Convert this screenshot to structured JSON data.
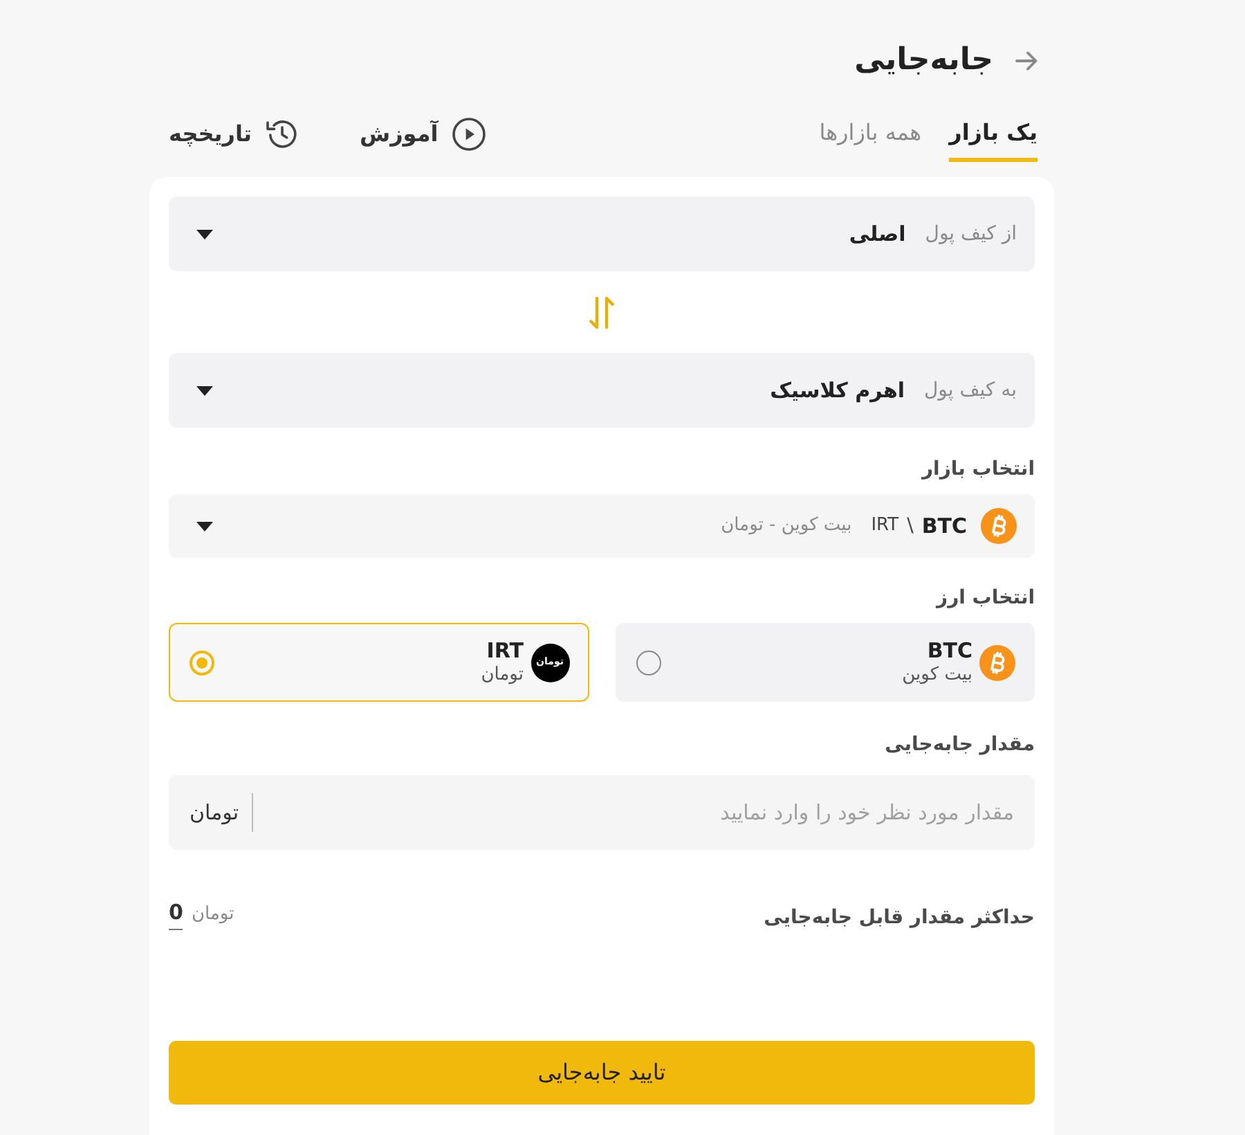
{
  "header": {
    "title": "جابه‌جایی"
  },
  "tabs": [
    {
      "label": "یک بازار",
      "selected": true
    },
    {
      "label": "همه بازارها",
      "selected": false
    }
  ],
  "links": [
    {
      "kind": "tutorial",
      "label": "آموزش"
    },
    {
      "kind": "history",
      "label": "تاریخچه"
    }
  ],
  "wallets": [
    {
      "label": "از کیف پول",
      "value": "اصلی"
    },
    {
      "label": "به کیف پول",
      "value": "اهرم کلاسیک"
    }
  ],
  "market": {
    "label": "انتخاب بازار",
    "symbol": "BTC",
    "separator": "\\",
    "quote": "IRT",
    "name": "بیت کوین - تومان"
  },
  "currency": {
    "label": "انتخاب ارز",
    "options": [
      {
        "kind": "bitcoin",
        "code": "BTC",
        "name": "بیت کوین",
        "selected": false
      },
      {
        "kind": "toman",
        "code": "IRT",
        "name": "تومان",
        "logo_text": "تومان",
        "selected": true
      }
    ]
  },
  "amount": {
    "label": "مقدار جابه‌جایی",
    "placeholder": "مقدار مورد نظر خود را وارد نمایید",
    "unit": "تومان"
  },
  "max": {
    "label": "حداکثر مقدار قابل جابه‌جایی",
    "unit": "تومان",
    "value": "0"
  },
  "confirm_button": {
    "label": "تایید جابه‌جایی"
  }
}
